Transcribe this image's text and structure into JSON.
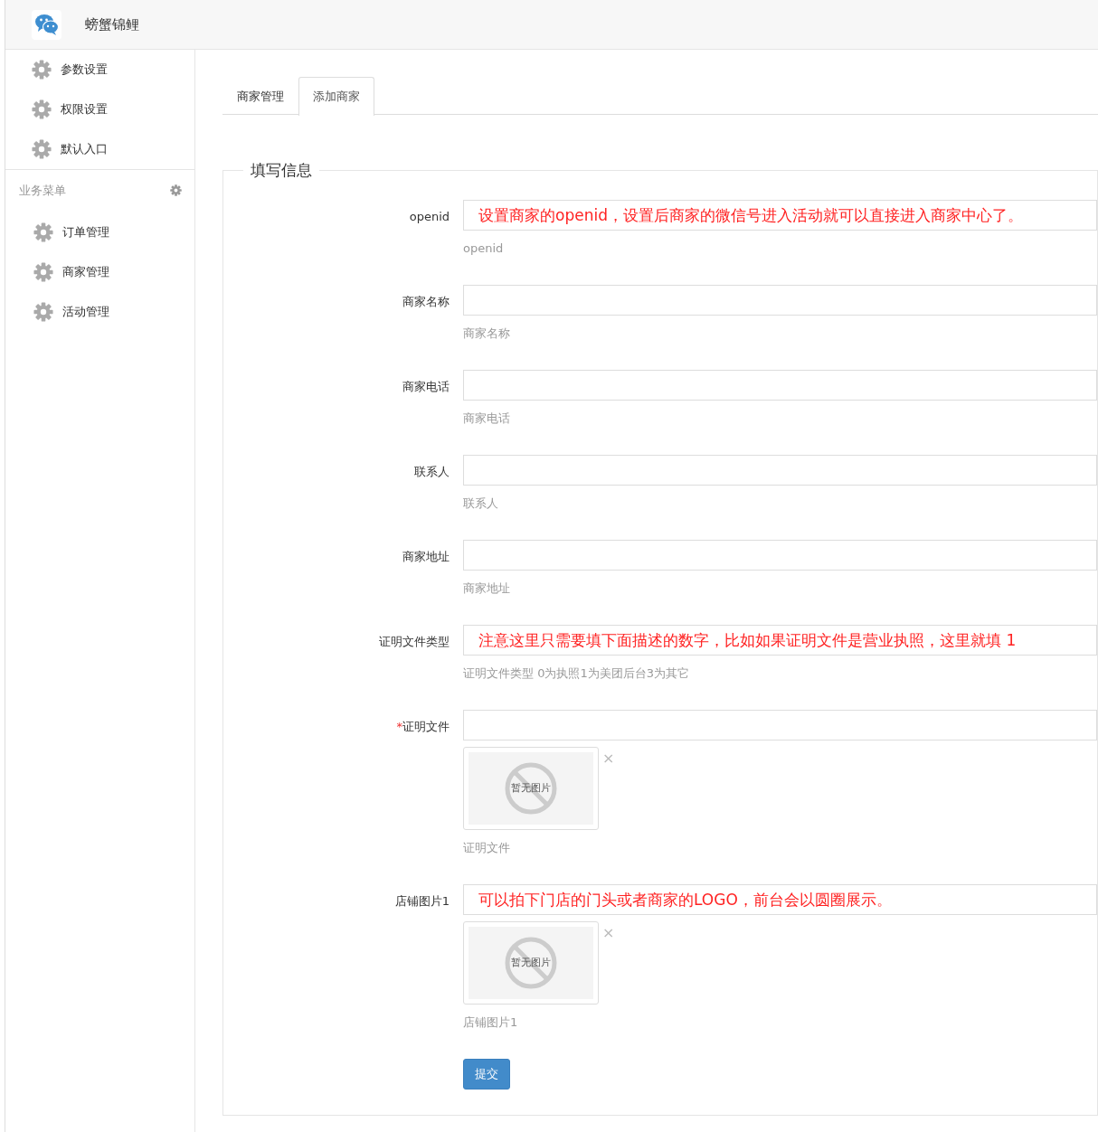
{
  "header": {
    "title": "螃蟹锦鲤"
  },
  "sidebar": {
    "items": [
      {
        "label": "参数设置"
      },
      {
        "label": "权限设置"
      },
      {
        "label": "默认入口"
      }
    ],
    "section": {
      "title": "业务菜单",
      "items": [
        {
          "label": "订单管理"
        },
        {
          "label": "商家管理"
        },
        {
          "label": "活动管理"
        }
      ]
    }
  },
  "tabs": [
    {
      "label": "商家管理",
      "selected": false
    },
    {
      "label": "添加商家",
      "selected": true
    }
  ],
  "form": {
    "legend": "填写信息",
    "fields": [
      {
        "kind": "text",
        "label": "openid",
        "note": "设置商家的openid，设置后商家的微信号进入活动就可以直接进入商家中心了。",
        "help": "openid"
      },
      {
        "kind": "text",
        "label": "商家名称",
        "help": "商家名称"
      },
      {
        "kind": "text",
        "label": "商家电话",
        "help": "商家电话"
      },
      {
        "kind": "text",
        "label": "联系人",
        "help": "联系人"
      },
      {
        "kind": "text",
        "label": "商家地址",
        "help": "商家地址"
      },
      {
        "kind": "text",
        "label": "证明文件类型",
        "note": "注意这里只需要填下面描述的数字，比如如果证明文件是营业执照，这里就填 1",
        "help": "证明文件类型 0为执照1为美团后台3为其它"
      },
      {
        "kind": "image",
        "label": "证明文件",
        "required_mark": "*",
        "empty_text": "暂无图片",
        "remove": "×",
        "help": "证明文件"
      },
      {
        "kind": "image",
        "label": "店铺图片1",
        "note": "可以拍下门店的门头或者商家的LOGO，前台会以圆圈展示。",
        "empty_text": "暂无图片",
        "remove": "×",
        "help": "店铺图片1"
      }
    ],
    "submit": "提交"
  }
}
